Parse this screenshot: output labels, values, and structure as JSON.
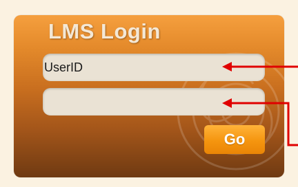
{
  "login": {
    "title": "LMS Login",
    "userid_value": "UserID",
    "password_value": "",
    "go_label": "Go"
  },
  "colors": {
    "page_background": "#fbf2e1",
    "panel_top": "#f59f3e",
    "panel_bottom": "#6f3a12",
    "button": "#f5950f",
    "annotation_arrow": "#e00000"
  },
  "icons": {
    "userid_arrow": "left-arrow-icon",
    "password_arrow": "left-arrow-icon"
  }
}
